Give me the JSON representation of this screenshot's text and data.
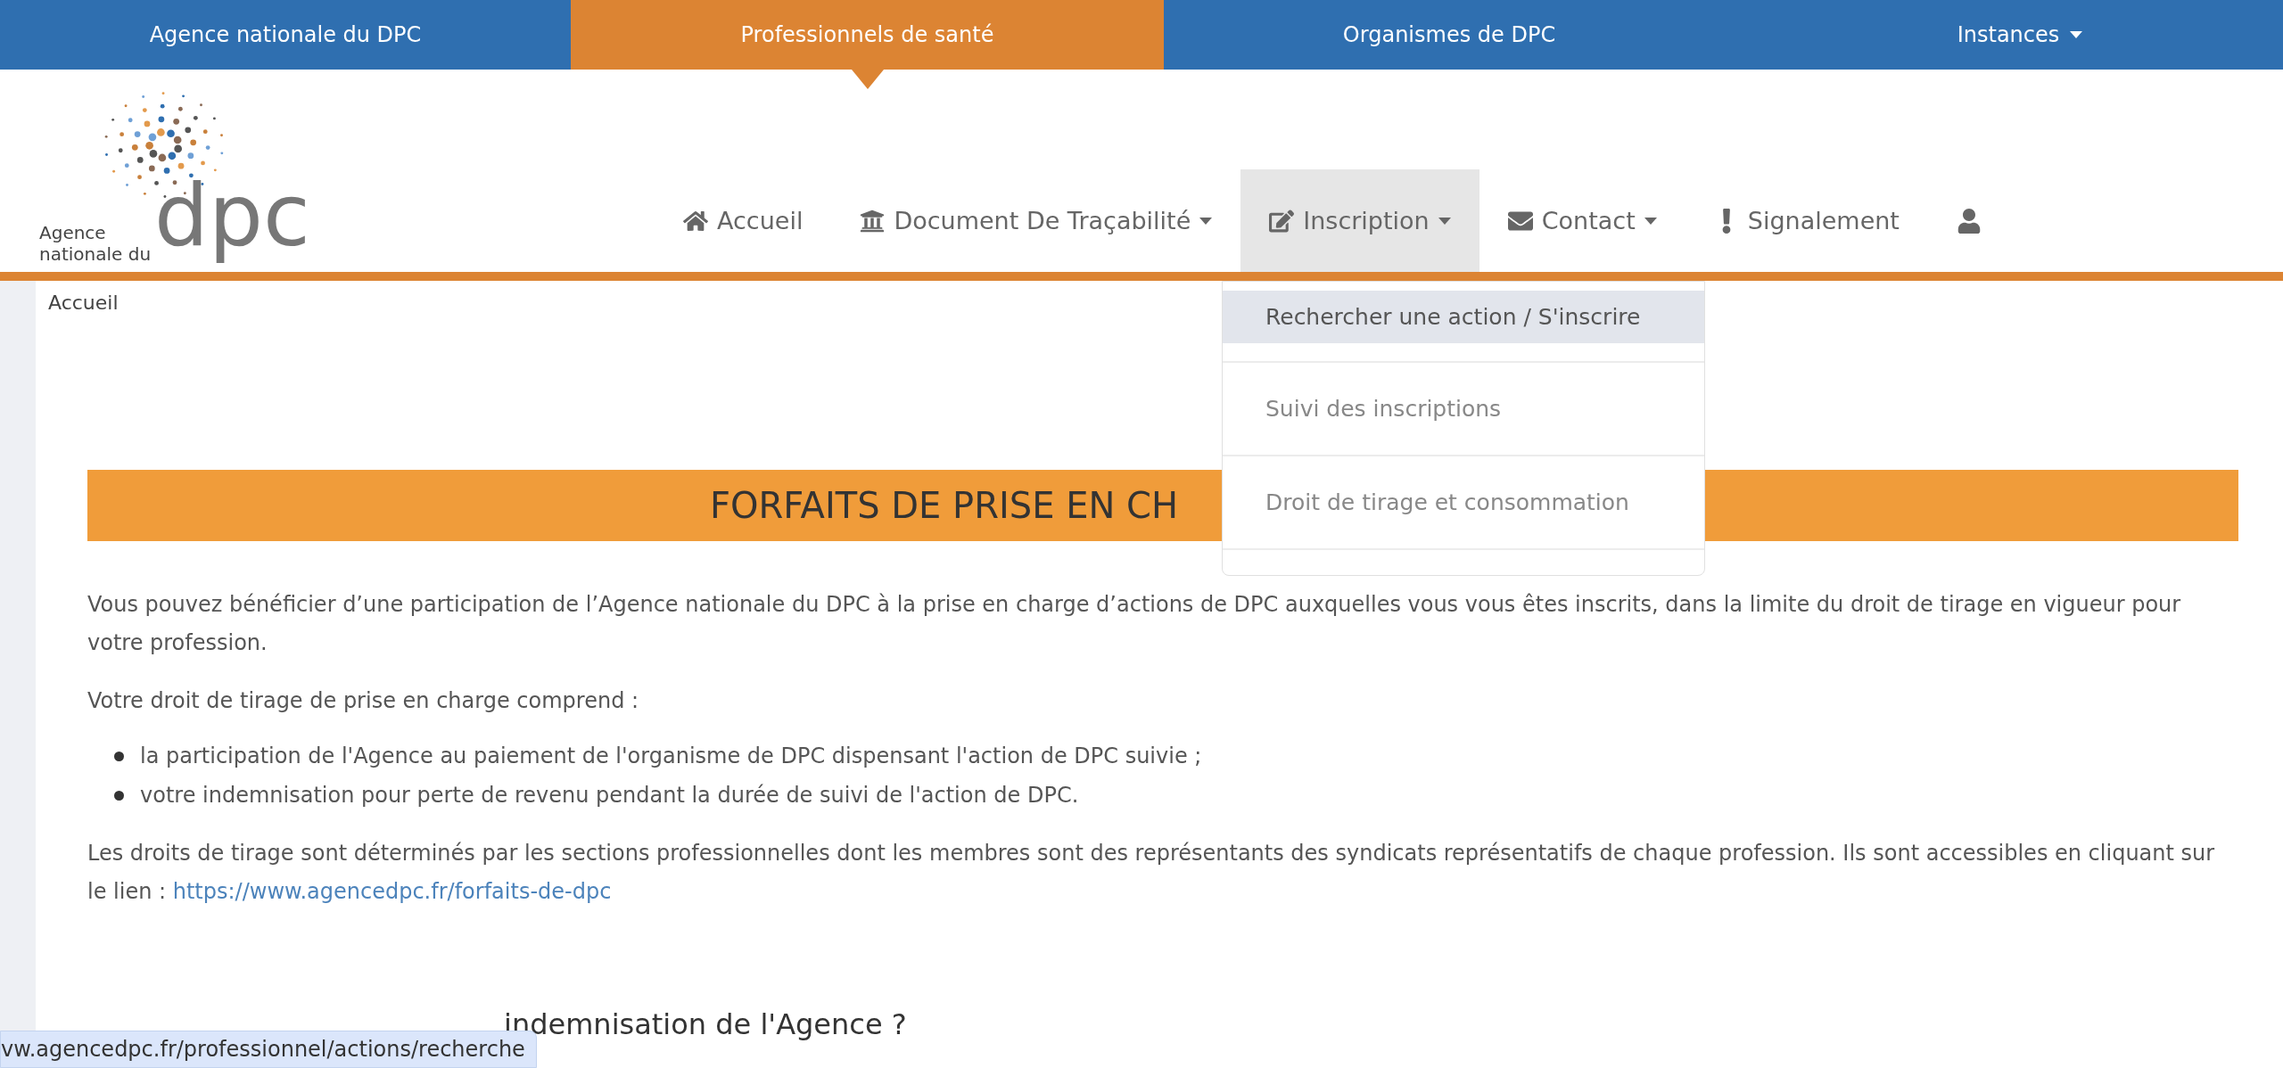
{
  "top_bar": [
    {
      "label": "Agence nationale du DPC",
      "selected": false,
      "has_menu": false
    },
    {
      "label": "Professionnels de santé",
      "selected": true,
      "has_menu": false
    },
    {
      "label": "Organismes de DPC",
      "selected": false,
      "has_menu": false
    },
    {
      "label": "Instances",
      "selected": false,
      "has_menu": true
    }
  ],
  "logo": {
    "line_1": "Agence",
    "line_2": "nationale du",
    "mark": "dpc"
  },
  "nav": [
    {
      "label": "Accueil",
      "selected": false,
      "has_menu": false
    },
    {
      "label": "Document De Traçabilité",
      "selected": false,
      "has_menu": true
    },
    {
      "label": "Inscription",
      "selected": true,
      "has_menu": true
    },
    {
      "label": "Contact",
      "selected": false,
      "has_menu": true
    },
    {
      "label": "Signalement",
      "selected": false,
      "has_menu": false
    },
    {
      "selected": false,
      "has_menu": false
    }
  ],
  "dropdown": [
    {
      "label": "Rechercher une action / S'inscrire",
      "selected": true
    },
    {
      "label": "Suivi des inscriptions",
      "selected": false
    },
    {
      "label": "Droit de tirage et consommation",
      "selected": false
    }
  ],
  "breadcrumb": "Accueil",
  "banner": "FORFAITS DE PRISE EN CH",
  "intro": "Vous pouvez bénéficier d’une participation de l’Agence nationale du DPC à la prise en charge d’actions de DPC auxquelles vous vous êtes inscrits, dans la limite du droit de tirage en vigueur pour votre profession.",
  "lead": "Votre droit de tirage de prise en charge comprend :",
  "bullets": [
    "la participation de l'Agence au paiement de l'organisme de DPC dispensant l'action de DPC suivie ;",
    "votre indemnisation pour perte de revenu pendant la durée de suivi de l'action de DPC."
  ],
  "rights": {
    "text": "Les droits de tirage sont déterminés par les sections professionnelles dont les membres sont des représentants des syndicats représentatifs de chaque profession. Ils sont accessibles en cliquant sur le lien :",
    "link": "https://www.agencedpc.fr/forfaits-de-dpc"
  },
  "next_heading": "indemnisation de l'Agence ?",
  "status_url": "vw.agencedpc.fr/professionnel/actions/recherche"
}
